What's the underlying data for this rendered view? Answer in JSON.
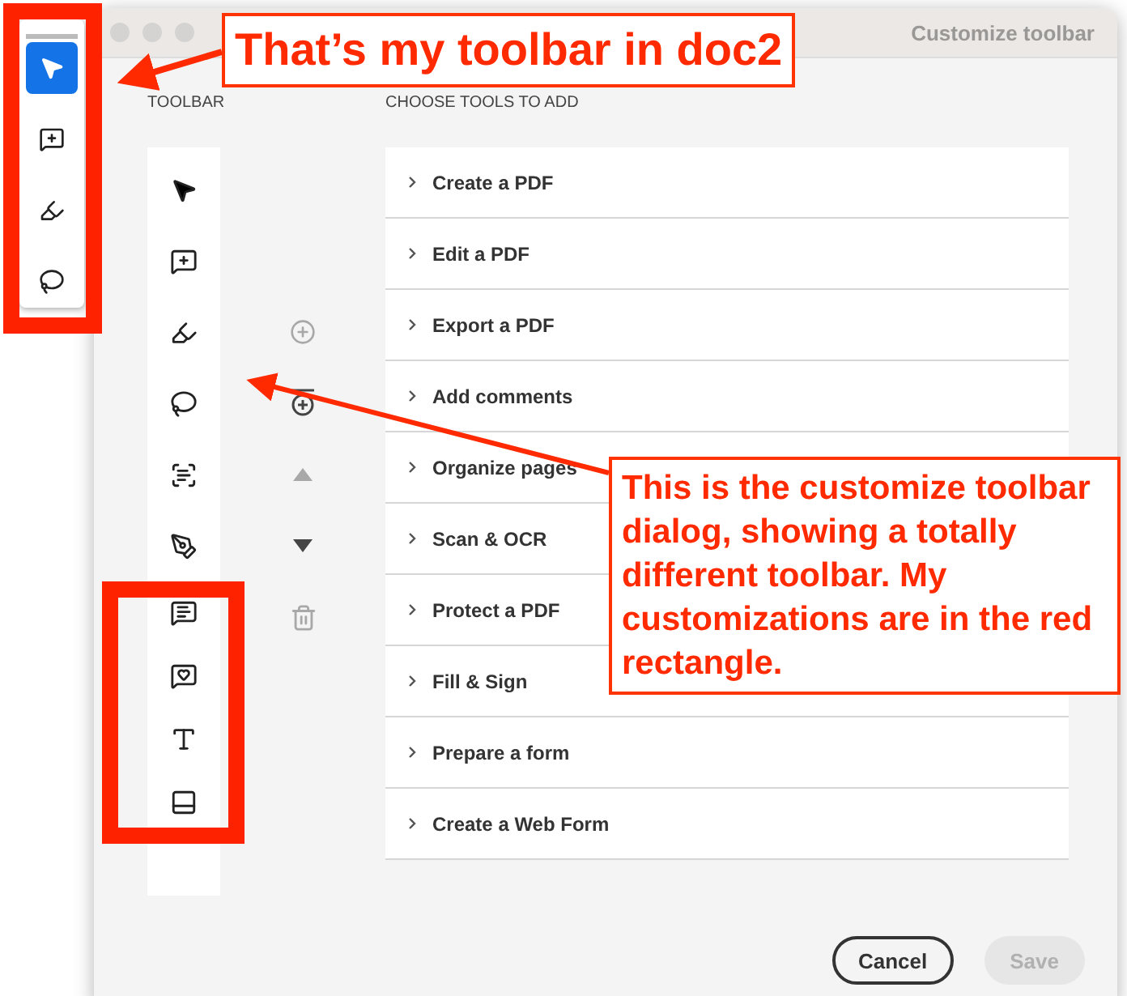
{
  "window": {
    "title": "Customize toolbar"
  },
  "doc_toolbar": {
    "items": [
      {
        "kind": "select",
        "selected": true
      },
      {
        "kind": "comment",
        "selected": false
      },
      {
        "kind": "highlight",
        "selected": false
      },
      {
        "kind": "lasso",
        "selected": false
      }
    ]
  },
  "toolbar_label": "TOOLBAR",
  "tools_label": "CHOOSE TOOLS TO ADD",
  "toolbar_tools": [
    {
      "kind": "select"
    },
    {
      "kind": "comment"
    },
    {
      "kind": "highlight"
    },
    {
      "kind": "lasso"
    },
    {
      "kind": "text-box"
    },
    {
      "kind": "sign"
    },
    {
      "kind": "strikethrough"
    },
    {
      "kind": "stamp"
    },
    {
      "kind": "add-text"
    },
    {
      "kind": "note"
    }
  ],
  "actions": [
    {
      "kind": "add",
      "disabled": true
    },
    {
      "kind": "separator",
      "disabled": false
    },
    {
      "kind": "up",
      "disabled": true
    },
    {
      "kind": "down",
      "disabled": false
    },
    {
      "kind": "delete",
      "disabled": true
    }
  ],
  "tool_groups": [
    "Create a PDF",
    "Edit a PDF",
    "Export a PDF",
    "Add comments",
    "Organize pages",
    "Scan & OCR",
    "Protect a PDF",
    "Fill & Sign",
    "Prepare a form",
    "Create a Web Form"
  ],
  "buttons": [
    {
      "label": "Cancel",
      "kind": "secondary",
      "disabled": false
    },
    {
      "label": "Save",
      "kind": "primary",
      "disabled": true
    }
  ],
  "callouts": [
    "That’s my toolbar in doc2",
    "This is the customize toolbar dialog, showing a totally different toolbar. My customizations are in the red rectangle."
  ]
}
